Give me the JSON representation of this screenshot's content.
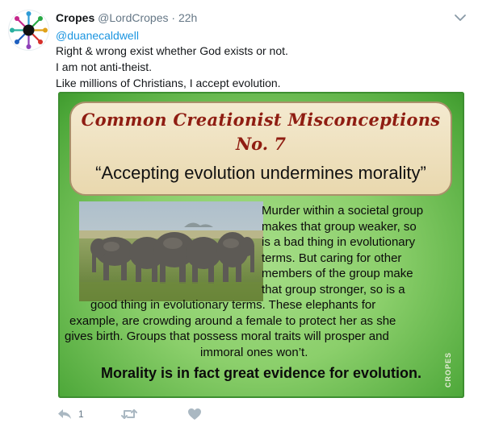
{
  "tweet": {
    "display_name": "Cropes",
    "handle": "@LordCropes",
    "separator": "·",
    "time": "22h",
    "reply_to": "@duanecaldwell",
    "text_lines": [
      "Right & wrong exist whether God exists or not.",
      "I am not anti-theist.",
      "Like millions of Christians, I accept evolution."
    ]
  },
  "image": {
    "title_line1": "Common Creationist Misconceptions",
    "title_line2": "No. 7",
    "quote": "“Accepting evolution undermines morality”",
    "body_lines": [
      "Murder within a societal group",
      "makes that group weaker, so",
      "is a bad thing in evolutionary",
      "terms. But caring for other",
      "members of the group make",
      "that group stronger, so is a",
      "good thing in evolutionary terms. These elephants for",
      "example, are crowding around a female to protect her as she",
      "gives birth. Groups that possess moral traits will prosper and",
      "immoral ones won’t."
    ],
    "conclusion": "Morality is in fact great evidence for evolution.",
    "watermark": "CROPES"
  },
  "actions": {
    "reply_icon": "reply-icon",
    "reply_count": "1",
    "retweet_icon": "retweet-icon",
    "like_icon": "heart-icon"
  },
  "colors": {
    "link": "#1b95e0",
    "muted": "#657786",
    "title_red": "#8f1d12",
    "panel_green": "#8bcf6b"
  }
}
